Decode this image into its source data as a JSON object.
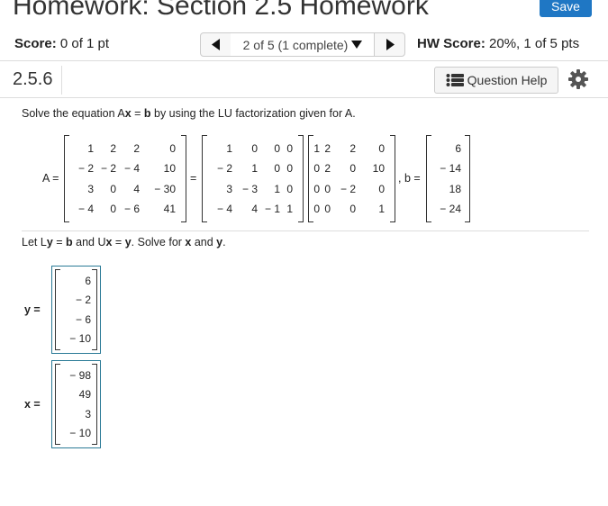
{
  "header": {
    "title": "Homework: Section 2.5 Homework",
    "save_label": "Save"
  },
  "score_bar": {
    "score_label": "Score:",
    "score_value": "0 of 1 pt",
    "question_selector": "2 of 5 (1 complete)",
    "hw_score_label": "HW Score:",
    "hw_score_value": "20%, 1 of 5 pts"
  },
  "question": {
    "number": "2.5.6",
    "help_label": "Question Help"
  },
  "instruction": {
    "t1": "Solve the equation A",
    "x": "x",
    "t2": " = ",
    "b": "b",
    "t3": " by using the LU factorization given for A."
  },
  "equation": {
    "a_label": "A =",
    "equals": "=",
    "b_label": ", b =",
    "A": [
      [
        "1",
        "2",
        "2",
        "0"
      ],
      [
        "− 2",
        "− 2",
        "− 4",
        "10"
      ],
      [
        "3",
        "0",
        "4",
        "− 30"
      ],
      [
        "− 4",
        "0",
        "− 6",
        "41"
      ]
    ],
    "L": [
      [
        "1",
        "0",
        "0",
        "0"
      ],
      [
        "− 2",
        "1",
        "0",
        "0"
      ],
      [
        "3",
        "− 3",
        "1",
        "0"
      ],
      [
        "− 4",
        "4",
        "− 1",
        "1"
      ]
    ],
    "U": [
      [
        "1",
        "2",
        "2",
        "0"
      ],
      [
        "0",
        "2",
        "0",
        "10"
      ],
      [
        "0",
        "0",
        "− 2",
        "0"
      ],
      [
        "0",
        "0",
        "0",
        "1"
      ]
    ],
    "b_vec": [
      "6",
      "− 14",
      "18",
      "− 24"
    ]
  },
  "let_text": {
    "t1": "Let L",
    "y1": "y",
    "t2": " = ",
    "b1": "b",
    "t3": " and U",
    "x1": "x",
    "t4": " = ",
    "y2": "y",
    "t5": ". Solve for ",
    "x2": "x",
    "t6": " and ",
    "y3": "y",
    "t7": "."
  },
  "answers": {
    "y_label": "y  =",
    "y_values": [
      "6",
      "− 2",
      "− 6",
      "− 10"
    ],
    "x_label": "x  =",
    "x_values": [
      "− 98",
      "49",
      "3",
      "− 10"
    ]
  },
  "colors": {
    "save_button": "#1f77c4",
    "answer_border": "#2a7a96"
  }
}
